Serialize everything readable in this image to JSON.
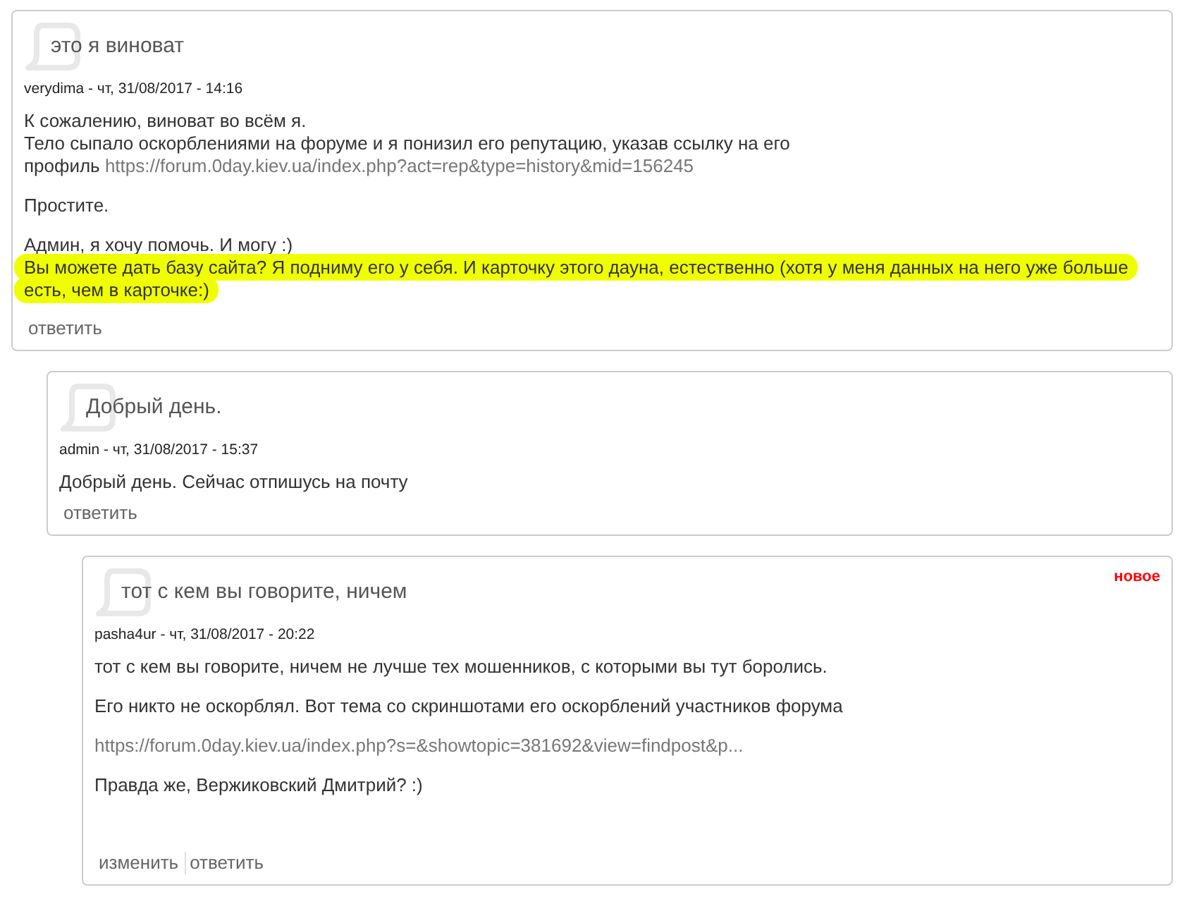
{
  "comments": [
    {
      "title": "это я виноват",
      "meta": "verydima - чт, 31/08/2017 - 14:16",
      "body": [
        {
          "lines": [
            {
              "text": "К сожалению, виноват во всём я.",
              "highlighted": false
            },
            {
              "text": "Тело сыпало оскорблениями на форуме и я понизил его репутацию, указав ссылку на его",
              "highlighted": false
            },
            {
              "text": "профиль",
              "link": "https://forum.0day.kiev.ua/index.php?act=rep&type=history&mid=156245",
              "highlighted": false
            }
          ]
        },
        {
          "lines": [
            {
              "text": "Простите.",
              "highlighted": false
            }
          ]
        },
        {
          "lines": [
            {
              "text": "Админ, я хочу помочь. И могу :)",
              "highlighted": false
            },
            {
              "text": "Вы можете дать базу сайта? Я подниму его у себя. И карточку этого дауна, естественно (хотя у меня данных на него уже больше",
              "highlighted": true
            },
            {
              "text": "есть, чем в карточке:)",
              "highlighted": true
            }
          ]
        }
      ],
      "links": [
        "ответить"
      ],
      "children": [
        {
          "title": "Добрый день.",
          "meta": "admin - чт, 31/08/2017 - 15:37",
          "body": [
            {
              "lines": [
                {
                  "text": "Добрый день. Сейчас отпишусь на почту",
                  "highlighted": false
                }
              ]
            }
          ],
          "links": [
            "ответить"
          ],
          "children": [
            {
              "title": "тот с кем вы говорите, ничем",
              "new_label": "новое",
              "meta": "pasha4ur - чт, 31/08/2017 - 20:22",
              "body": [
                {
                  "lines": [
                    {
                      "text": "тот с кем вы говорите, ничем не лучше тех мошенников, с которыми вы тут боролись.",
                      "highlighted": false
                    }
                  ]
                },
                {
                  "lines": [
                    {
                      "text": "Его никто не оскорблял. Вот тема со скриншотами его оскорблений участников форума",
                      "highlighted": false
                    }
                  ]
                },
                {
                  "lines": [
                    {
                      "link": "https://forum.0day.kiev.ua/index.php?s=&showtopic=381692&view=findpost&p...",
                      "highlighted": false
                    }
                  ]
                },
                {
                  "lines": [
                    {
                      "text": "Правда же, Вержиковский Дмитрий? :)",
                      "highlighted": false
                    }
                  ]
                }
              ],
              "links": [
                "изменить",
                "ответить"
              ]
            }
          ]
        }
      ]
    }
  ]
}
